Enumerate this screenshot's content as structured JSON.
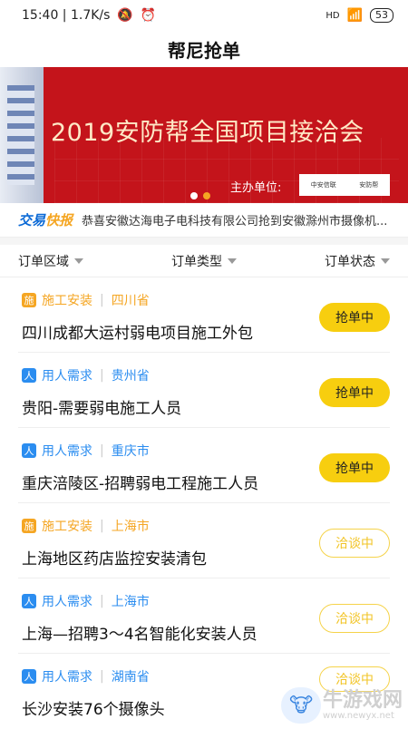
{
  "status_bar": {
    "time_speed": "15:40 | 1.7K/s",
    "signal": "HD",
    "battery": "53"
  },
  "header": {
    "title": "帮尼抢单"
  },
  "banner": {
    "headline": "2019安防帮全国项目接洽会",
    "host_label": "主办单位:",
    "logo1": "中安信联",
    "logo2": "安防帮"
  },
  "ticker": {
    "brand_part1": "交易",
    "brand_part2": "快报",
    "message": "恭喜安徽达海电子电科技有限公司抢到安徽滁州市摄像机..."
  },
  "filters": [
    {
      "label": "订单区域"
    },
    {
      "label": "订单类型"
    },
    {
      "label": "订单状态"
    }
  ],
  "orders": [
    {
      "badge": "施",
      "category": "施工安装",
      "region": "四川省",
      "title": "四川成都大运村弱电项目施工外包",
      "status": "抢单中"
    },
    {
      "badge": "人",
      "category": "用人需求",
      "region": "贵州省",
      "title": "贵阳-需要弱电施工人员",
      "status": "抢单中"
    },
    {
      "badge": "人",
      "category": "用人需求",
      "region": "重庆市",
      "title": "重庆涪陵区-招聘弱电工程施工人员",
      "status": "抢单中"
    },
    {
      "badge": "施",
      "category": "施工安装",
      "region": "上海市",
      "title": "上海地区药店监控安装清包",
      "status": "洽谈中"
    },
    {
      "badge": "人",
      "category": "用人需求",
      "region": "上海市",
      "title": "上海—招聘3～4名智能化安装人员",
      "status": "洽谈中"
    },
    {
      "badge": "人",
      "category": "用人需求",
      "region": "湖南省",
      "title": "长沙安装76个摄像头",
      "status": "洽谈中"
    }
  ],
  "watermark": {
    "text": "牛游戏网",
    "sub": "www.newyx.net"
  }
}
